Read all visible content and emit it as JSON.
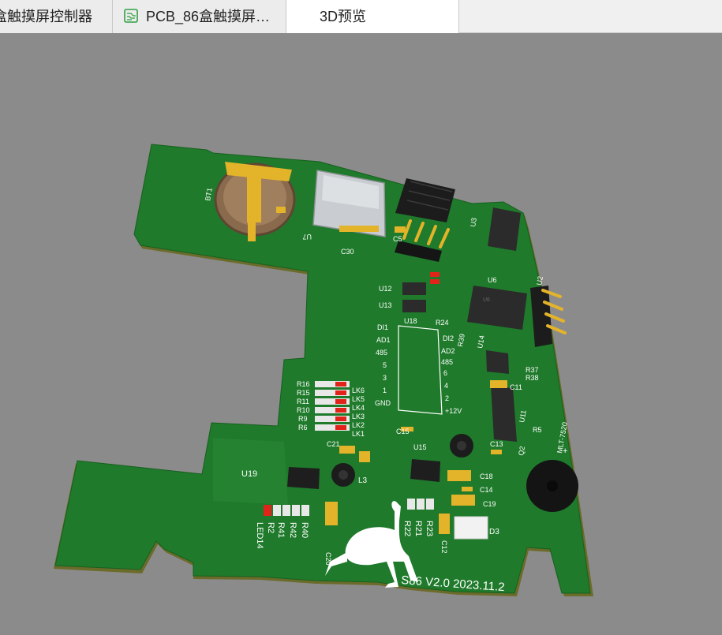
{
  "tabs": [
    {
      "label": "盒触摸屏控制器"
    },
    {
      "label": "PCB_86盒触摸屏…",
      "icon": "pcb-document-icon"
    },
    {
      "label": "3D预览"
    }
  ],
  "board": {
    "silkscreen_text": "S86  V2.0  2023.11.2",
    "components": [
      "BT1",
      "U7",
      "C5",
      "C30",
      "R1",
      "U12",
      "U13",
      "U18",
      "U6",
      "U3",
      "U2",
      "C11",
      "R37",
      "R38",
      "R39",
      "U14",
      "U11",
      "R5",
      "Q2",
      "R16",
      "R15",
      "R11",
      "R10",
      "R9",
      "R6",
      "LK6",
      "LK5",
      "LK4",
      "LK3",
      "LK2",
      "LK1",
      "C21",
      "C15",
      "U15",
      "L3",
      "U19",
      "C13",
      "C18",
      "C14",
      "C19",
      "C12",
      "D3",
      "R22",
      "R21",
      "R23",
      "C20",
      "R40",
      "R42",
      "R41",
      "R2",
      "LED14",
      "MLT-7520",
      "R24"
    ],
    "header_labels_left": [
      "DI1",
      "AD1",
      "485",
      "5",
      "3",
      "1",
      "GND"
    ],
    "header_labels_right": [
      "DI2",
      "AD2",
      "485",
      "6",
      "4",
      "2",
      "+12V"
    ],
    "colors": {
      "pcb": "#1f7a2b",
      "silk": "#ffffff",
      "gold": "#e3b32a",
      "background": "#8b8b8b"
    }
  }
}
